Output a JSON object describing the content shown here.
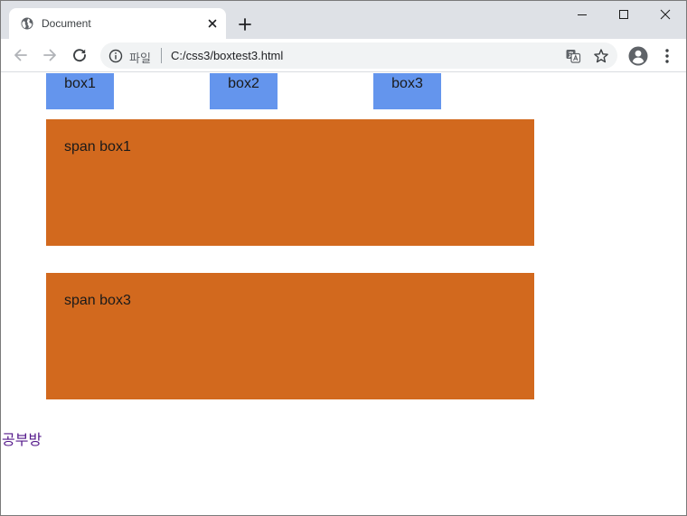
{
  "browser": {
    "tab": {
      "title": "Document"
    },
    "omnibox": {
      "scheme_label": "파일",
      "url": "C:/css3/boxtest3.html"
    },
    "icons": [
      "globe-icon",
      "close-icon",
      "plus-icon",
      "back-arrow-icon",
      "forward-arrow-icon",
      "reload-icon",
      "info-icon",
      "translate-icon",
      "star-icon",
      "profile-icon",
      "kebab-menu-icon",
      "minimize-icon",
      "maximize-icon",
      "window-close-icon"
    ]
  },
  "page": {
    "boxes": [
      "box1",
      "box2",
      "box3"
    ],
    "span_boxes": [
      "span box1",
      "span box3"
    ],
    "link": "공부방"
  },
  "colors": {
    "box_blue": "#6495ed",
    "span_orange": "#d2691e",
    "visited_link": "#551a8b",
    "tabstrip": "#dee1e6"
  }
}
